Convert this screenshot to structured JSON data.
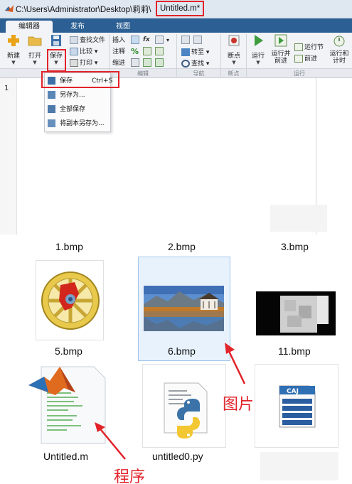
{
  "window": {
    "title_path": "C:\\Users\\Administrator\\Desktop\\莉莉\\",
    "title_file": "Untitled.m*"
  },
  "tabs": [
    {
      "label": "编辑器",
      "active": true
    },
    {
      "label": "发布",
      "active": false
    },
    {
      "label": "视图",
      "active": false
    }
  ],
  "ribbon": {
    "new_label": "新建",
    "open_label": "打开",
    "save_label": "保存",
    "find_files_label": "查找文件",
    "compare_label": "比较",
    "print_label": "打印",
    "insert_label": "插入",
    "comment_label": "注释",
    "indent_label": "缩进",
    "fx_label": "fx",
    "goto_label": "转至",
    "find_label": "查找",
    "breakpoints_label": "断点",
    "run_label": "运行",
    "run_advance_label": "运行并\n前进",
    "run_section_label": "运行节",
    "advance_label": "前进",
    "run_time_label": "运行和\n计时",
    "groups": {
      "edit": "编辑",
      "navigate": "导航",
      "breakpoints": "断点",
      "run": "运行"
    }
  },
  "save_menu": {
    "items": [
      {
        "label": "保存",
        "shortcut": "Ctrl+S"
      },
      {
        "label": "另存为..."
      },
      {
        "label": "全部保存"
      },
      {
        "label": "将副本另存为..."
      }
    ]
  },
  "editor": {
    "line_number": "1"
  },
  "files": {
    "top_row_labels": [
      "1.bmp",
      "2.bmp",
      "3.bmp"
    ],
    "middle_row_labels": [
      "5.bmp",
      "6.bmp",
      "11.bmp"
    ],
    "bottom_row_labels": [
      "Untitled.m",
      "untitled0.py"
    ],
    "icons": [
      "wheel-image",
      "lake-image",
      "blurred-image",
      "matlab-file-icon",
      "python-file-icon",
      "caj-file-icon"
    ]
  },
  "annotations": {
    "picture_label": "图片",
    "program_label": "程序"
  },
  "colors": {
    "highlight_red": "#e2232a",
    "tab_blue": "#2c5f93",
    "selection": "#e8f2fd"
  }
}
